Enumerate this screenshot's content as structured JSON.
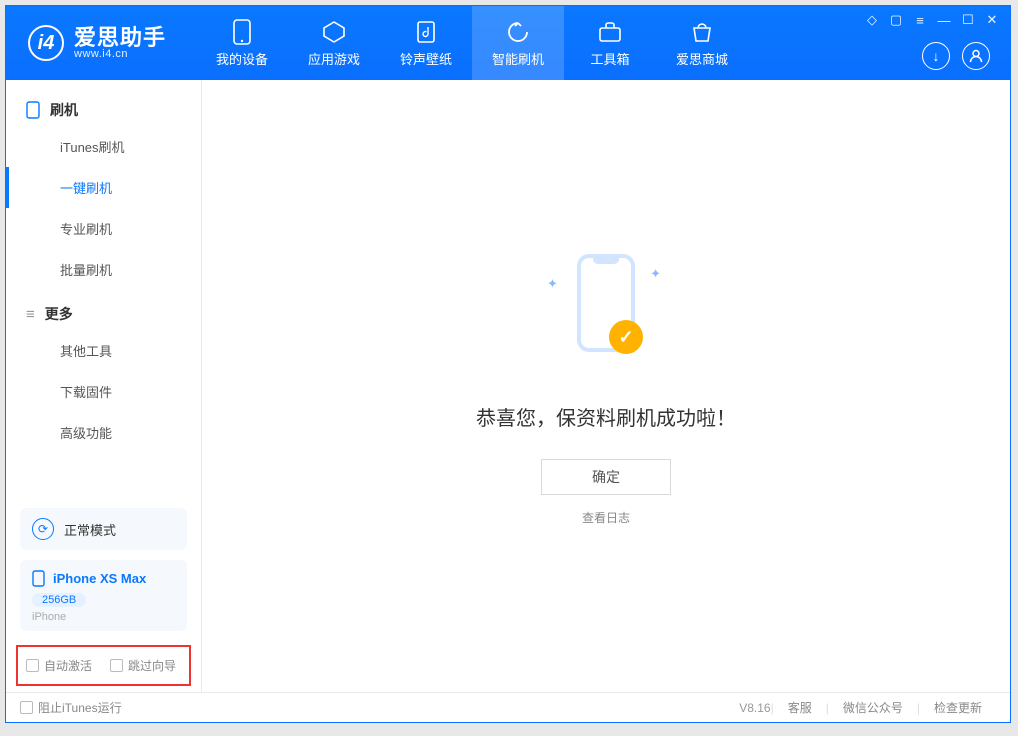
{
  "app": {
    "title": "爱思助手",
    "subtitle": "www.i4.cn"
  },
  "tabs": [
    {
      "label": "我的设备",
      "icon": "device-icon"
    },
    {
      "label": "应用游戏",
      "icon": "apps-icon"
    },
    {
      "label": "铃声壁纸",
      "icon": "ringtone-icon"
    },
    {
      "label": "智能刷机",
      "icon": "flash-icon"
    },
    {
      "label": "工具箱",
      "icon": "toolbox-icon"
    },
    {
      "label": "爱思商城",
      "icon": "shop-icon"
    }
  ],
  "sidebar": {
    "group1": {
      "title": "刷机",
      "items": [
        "iTunes刷机",
        "一键刷机",
        "专业刷机",
        "批量刷机"
      ]
    },
    "group2": {
      "title": "更多",
      "items": [
        "其他工具",
        "下载固件",
        "高级功能"
      ]
    }
  },
  "device": {
    "mode_label": "正常模式",
    "name": "iPhone XS Max",
    "storage": "256GB",
    "type": "iPhone"
  },
  "options": {
    "auto_activate": "自动激活",
    "skip_guide": "跳过向导"
  },
  "main": {
    "success_message": "恭喜您，保资料刷机成功啦！",
    "ok_button": "确定",
    "view_log": "查看日志"
  },
  "footer": {
    "block_itunes": "阻止iTunes运行",
    "version": "V8.16",
    "links": [
      "客服",
      "微信公众号",
      "检查更新"
    ]
  }
}
